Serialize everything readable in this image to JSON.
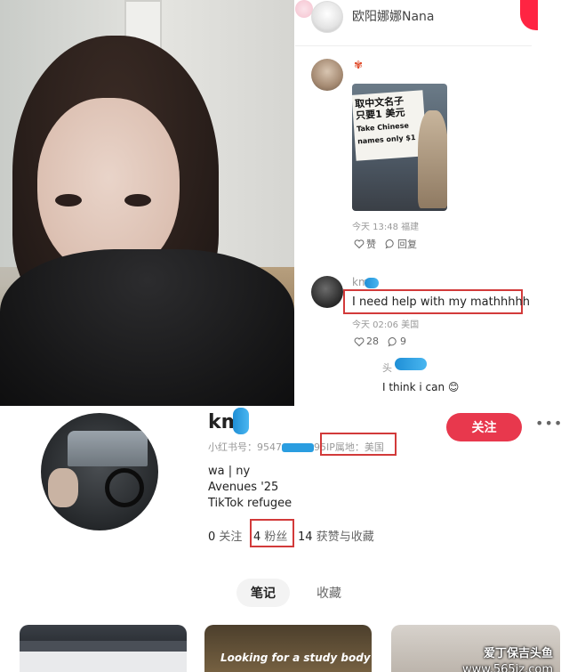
{
  "colors": {
    "brand_red": "#ff2442",
    "follow_red": "#e8384d",
    "highlight_box": "#d23a3a",
    "redaction_blue": "#2a9de0"
  },
  "comments": {
    "header_user": "欧阳娜娜Nana",
    "first_comment": {
      "badge_icon": "maple-leaf-icon",
      "image_sign_cn_line1": "取中文名子",
      "image_sign_cn_line2": "只要1 美元",
      "image_sign_en_line1": "Take Chinese",
      "image_sign_en_line2": "names only $1",
      "time_location": "今天 13:48 福建",
      "like_label": "赞",
      "reply_label": "回复"
    },
    "second_comment": {
      "username": "km",
      "text": "I need help with my mathhhhh",
      "time_location": "今天 02:06 美国",
      "likes": "28",
      "replies": "9"
    },
    "reply": {
      "username": "头",
      "text": "I think i can"
    }
  },
  "profile": {
    "name": "km",
    "id_label": "小红书号：9547",
    "id_suffix": "95",
    "ip_label": "IP属地：美国",
    "follow_button": "关注",
    "more_icon": "more-dots-icon",
    "bio_line1": "wa | ny",
    "bio_line2": "Avenues '25",
    "bio_line3": "TikTok refugee",
    "stats": {
      "following_count": "0",
      "following_label": "关注",
      "followers_count": "4",
      "followers_label": "粉丝",
      "likes_count": "14",
      "likes_label": "获赞与收藏"
    },
    "tabs": [
      "笔记",
      "收藏"
    ],
    "card2_caption": "Looking for a study body"
  },
  "watermark": {
    "line1": "爱丁保吉头鱼",
    "line2": "www.565jz.com"
  }
}
